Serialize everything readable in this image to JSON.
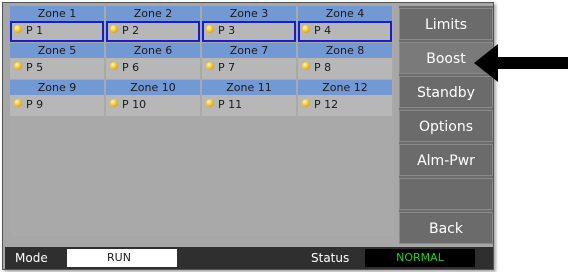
{
  "zones": [
    {
      "name": "Zone 1",
      "label": "P 1",
      "selected": true
    },
    {
      "name": "Zone 2",
      "label": "P 2",
      "selected": true
    },
    {
      "name": "Zone 3",
      "label": "P 3",
      "selected": true
    },
    {
      "name": "Zone 4",
      "label": "P 4",
      "selected": true
    },
    {
      "name": "Zone 5",
      "label": "P 5",
      "selected": false
    },
    {
      "name": "Zone 6",
      "label": "P 6",
      "selected": false
    },
    {
      "name": "Zone 7",
      "label": "P 7",
      "selected": false
    },
    {
      "name": "Zone 8",
      "label": "P 8",
      "selected": false
    },
    {
      "name": "Zone 9",
      "label": "P 9",
      "selected": false
    },
    {
      "name": "Zone 10",
      "label": "P 10",
      "selected": false
    },
    {
      "name": "Zone 11",
      "label": "P 11",
      "selected": false
    },
    {
      "name": "Zone 12",
      "label": "P 12",
      "selected": false
    }
  ],
  "sidebar": {
    "limits": "Limits",
    "boost": "Boost",
    "standby": "Standby",
    "options": "Options",
    "alm_pwr": "Alm-Pwr",
    "empty": "",
    "back": "Back"
  },
  "statusbar": {
    "mode_label": "Mode",
    "mode_value": "RUN",
    "status_label": "Status",
    "status_value": "NORMAL"
  },
  "colors": {
    "zone_header": "#7399d4",
    "selection_border": "#1420d0",
    "led": "#f0c020",
    "status_ok": "#20d020"
  },
  "icons": {
    "zone_indicator": "led-dot-icon",
    "pointer": "arrow-left-icon"
  }
}
